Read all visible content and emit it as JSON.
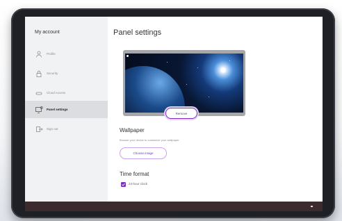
{
  "sidebar": {
    "title": "My account",
    "items": [
      {
        "label": "Profile",
        "icon": "person-icon",
        "active": false
      },
      {
        "label": "Security",
        "icon": "lock-icon",
        "active": false
      },
      {
        "label": "Cloud Access",
        "icon": "cloud-icon",
        "active": false
      },
      {
        "label": "Panel settings",
        "icon": "panel-icon",
        "active": true
      },
      {
        "label": "Sign out",
        "icon": "sign-out-icon",
        "active": false
      }
    ]
  },
  "main": {
    "title": "Panel settings",
    "wallpaper": {
      "remove_label": "Remove",
      "title": "Wallpaper",
      "description": "Browse your device to customize your wallpaper",
      "choose_label": "Choose image"
    },
    "time_format": {
      "title": "Time format",
      "checkbox_label": "24-hour clock",
      "checked": true
    }
  },
  "colors": {
    "accent": "#7b2fbf",
    "sidebar_bg": "#f1f2f4",
    "taskbar_bg": "#3b2b2e"
  }
}
